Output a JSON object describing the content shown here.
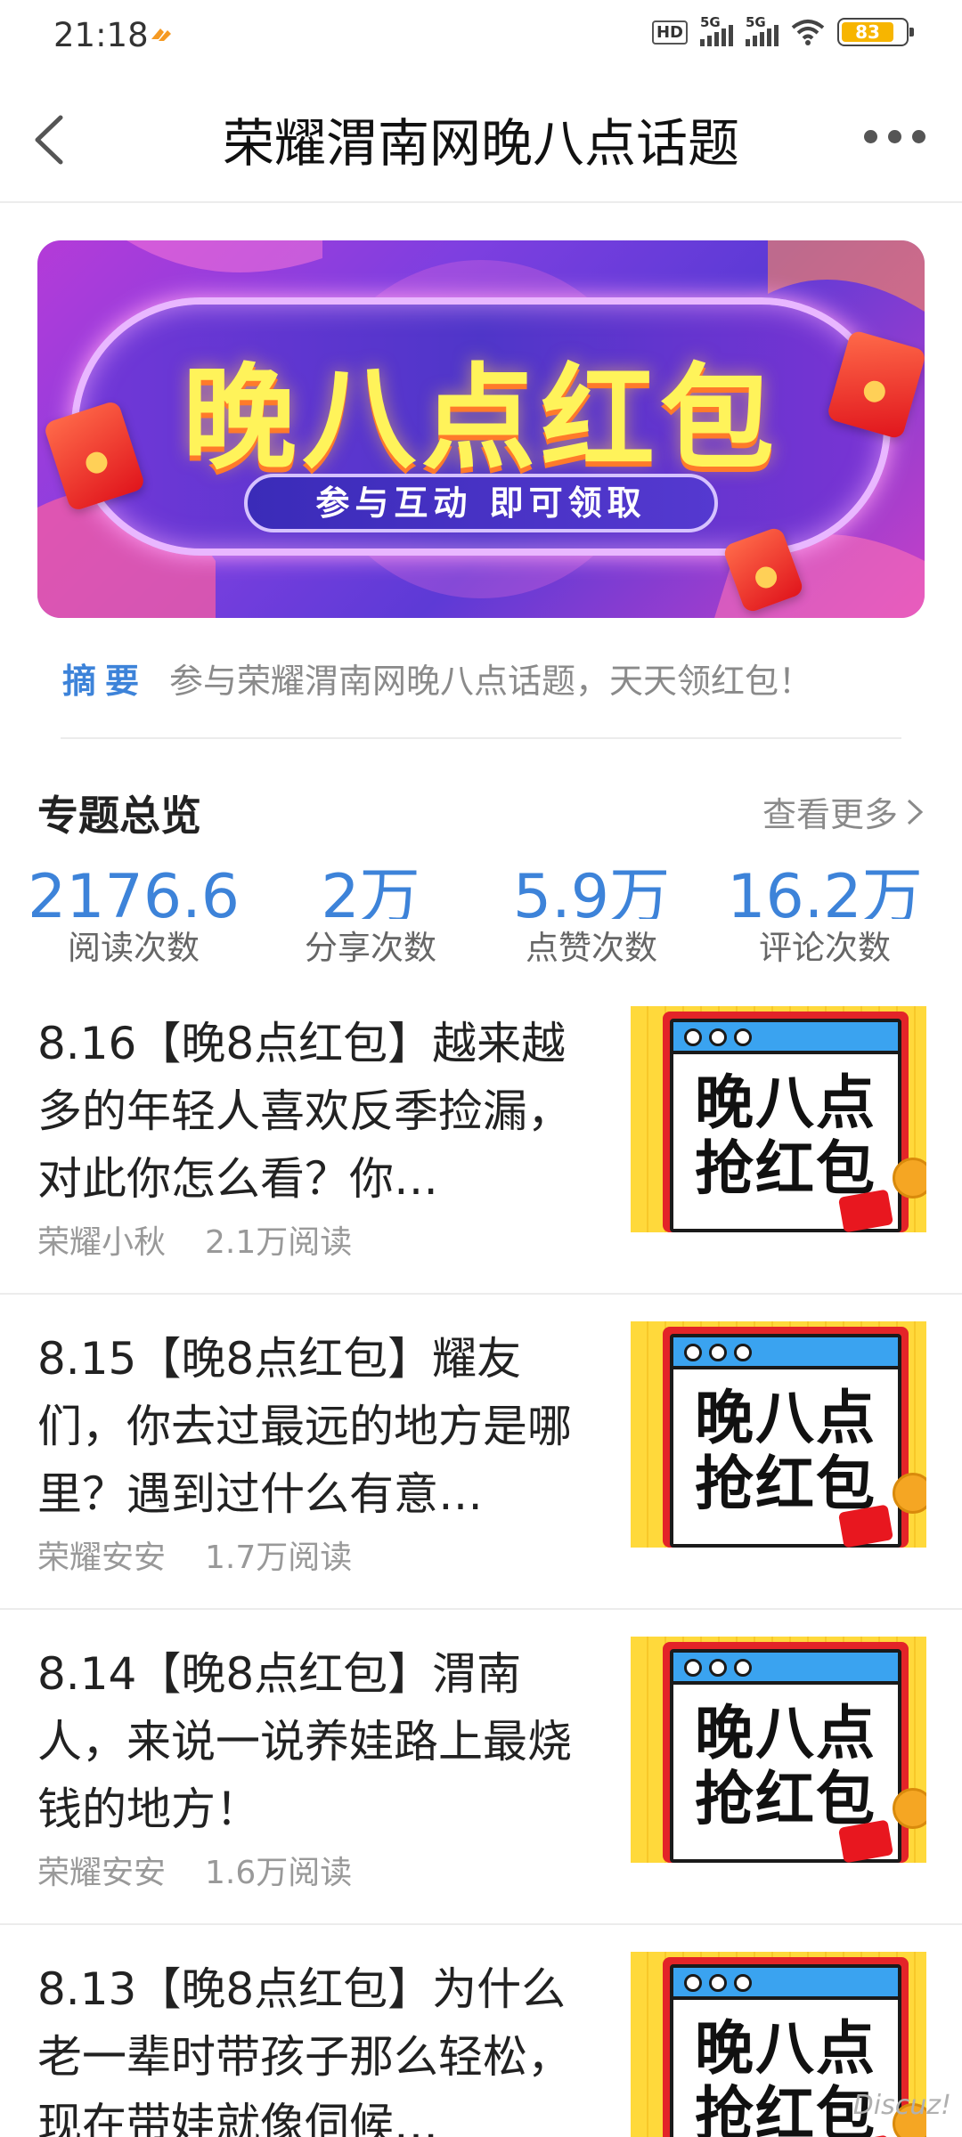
{
  "status_bar": {
    "time": "21:18",
    "hd_label": "HD",
    "signal1_label": "5G",
    "signal2_label": "5G",
    "battery_level": "83"
  },
  "nav": {
    "title": "荣耀渭南网晚八点话题",
    "back_icon": "back-arrow-icon",
    "more_icon": "more-dots-icon"
  },
  "banner": {
    "title": "晚八点红包",
    "subtitle": "参与互动 即可领取"
  },
  "summary": {
    "tag": "摘要",
    "text": "参与荣耀渭南网晚八点话题，天天领红包！"
  },
  "overview": {
    "title": "专题总览",
    "more_label": "查看更多",
    "stats": [
      {
        "value": "2176.6",
        "label": "阅读次数"
      },
      {
        "value": "2万",
        "label": "分享次数"
      },
      {
        "value": "5.9万",
        "label": "点赞次数"
      },
      {
        "value": "16.2万",
        "label": "评论次数"
      }
    ]
  },
  "articles": [
    {
      "title": "8.16【晚8点红包】越来越多的年轻人喜欢反季捡漏，对此你怎么看？你…",
      "author": "荣耀小秋",
      "reads": "2.1万阅读",
      "thumb_text": "晚八点抢红包"
    },
    {
      "title": "8.15【晚8点红包】耀友们，你去过最远的地方是哪里？遇到过什么有意…",
      "author": "荣耀安安",
      "reads": "1.7万阅读",
      "thumb_text": "晚八点抢红包"
    },
    {
      "title": "8.14【晚8点红包】渭南人，来说一说养娃路上最烧钱的地方！",
      "author": "荣耀安安",
      "reads": "1.6万阅读",
      "thumb_text": "晚八点抢红包"
    },
    {
      "title": "8.13【晚8点红包】为什么老一辈时带孩子那么轻松，现在带娃就像伺候…",
      "author": "",
      "reads": "",
      "thumb_text": "晚八点抢红包"
    }
  ],
  "thumb": {
    "line1": "晚八点",
    "line2": "抢红包"
  },
  "watermark": "Discuz!",
  "colors": {
    "accent": "#3d83d9",
    "banner_title": "#fff35a",
    "battery": "#f7b500"
  }
}
